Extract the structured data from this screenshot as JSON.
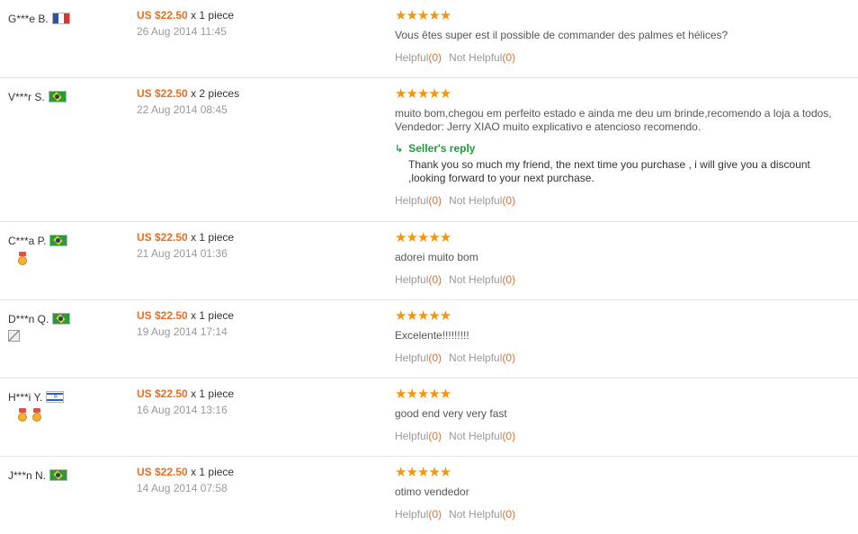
{
  "helpful_label": "Helpful",
  "not_helpful_label": "Not Helpful",
  "seller_reply_label": "Seller's reply",
  "star_glyphs": "★★★★★",
  "reviews": [
    {
      "buyer": "G***e B.",
      "country": "fr",
      "price": "US $22.50",
      "qty": "x 1 piece",
      "date": "26 Aug 2014 11:45",
      "rating": 5,
      "text": "Vous êtes super est il possible de commander des palmes et hélices?",
      "helpful_count": "(0)",
      "not_helpful_count": "(0)"
    },
    {
      "buyer": "V***r S.",
      "country": "br",
      "price": "US $22.50",
      "qty": "x 2 pieces",
      "date": "22 Aug 2014 08:45",
      "rating": 5,
      "text": "muito bom,chegou em perfeito estado e ainda me deu um brinde,recomendo a loja a todos,\nVendedor: Jerry XIAO muito explicativo e atencioso recomendo.",
      "seller_reply": "Thank you so much my friend, the next time you purchase , i will give you a discount\n,looking forward to your next purchase.",
      "helpful_count": "(0)",
      "not_helpful_count": "(0)"
    },
    {
      "buyer": "C***a P.",
      "country": "br",
      "badges": [
        "medal"
      ],
      "price": "US $22.50",
      "qty": "x 1 piece",
      "date": "21 Aug 2014 01:36",
      "rating": 5,
      "text": "adorei muito bom",
      "helpful_count": "(0)",
      "not_helpful_count": "(0)"
    },
    {
      "buyer": "D***n Q.",
      "country": "br",
      "badges": [
        "blank"
      ],
      "price": "US $22.50",
      "qty": "x 1 piece",
      "date": "19 Aug 2014 17:14",
      "rating": 5,
      "text": "Excelente!!!!!!!!!",
      "helpful_count": "(0)",
      "not_helpful_count": "(0)"
    },
    {
      "buyer": "H***i Y.",
      "country": "il",
      "badges": [
        "medal",
        "medal"
      ],
      "price": "US $22.50",
      "qty": "x 1 piece",
      "date": "16 Aug 2014 13:16",
      "rating": 5,
      "text": "good end very very fast",
      "helpful_count": "(0)",
      "not_helpful_count": "(0)"
    },
    {
      "buyer": "J***n N.",
      "country": "br",
      "price": "US $22.50",
      "qty": "x 1 piece",
      "date": "14 Aug 2014 07:58",
      "rating": 5,
      "text": "otimo vendedor",
      "helpful_count": "(0)",
      "not_helpful_count": "(0)"
    }
  ]
}
